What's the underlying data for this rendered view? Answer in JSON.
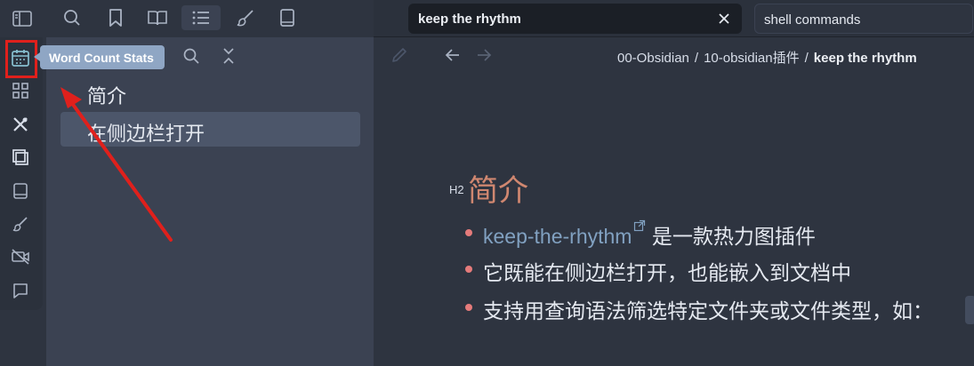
{
  "tooltip": {
    "text": "Word Count Stats"
  },
  "tab": {
    "title": "keep the rhythm"
  },
  "search_tab": {
    "title": "shell commands"
  },
  "outline": {
    "items": [
      {
        "label": "简介"
      },
      {
        "label": "在侧边栏打开"
      }
    ]
  },
  "breadcrumb": {
    "part1": "00-Obsidian",
    "separator": "/",
    "part2": "10-obsidian插件",
    "current": "keep the rhythm"
  },
  "document": {
    "heading_tag": "H2",
    "heading": "简介",
    "bullets": [
      {
        "link": "keep-the-rhythm",
        "text": " 是一款热力图插件"
      },
      {
        "text": "它既能在侧边栏打开，也能嵌入到文档中"
      },
      {
        "text": "支持用查询语法筛选特定文件夹或文件类型，如："
      }
    ]
  },
  "colors": {
    "background": "#2e3440",
    "panel": "#3b4252",
    "accent_heading": "#d08770",
    "link": "#81a1c1",
    "tooltip": "#8fa6c4",
    "annotation_red": "#e0201c"
  },
  "icons": {
    "top_toolbar": [
      "sidebar-toggle-icon",
      "search-icon",
      "bookmark-icon",
      "book-open-icon",
      "list-icon",
      "brush-icon",
      "book-icon"
    ],
    "ribbon": [
      "calendar-icon",
      "dashboard-icon",
      "tools-icon",
      "layers-icon",
      "book-icon",
      "brush-icon",
      "camera-off-icon",
      "comment-icon"
    ]
  }
}
